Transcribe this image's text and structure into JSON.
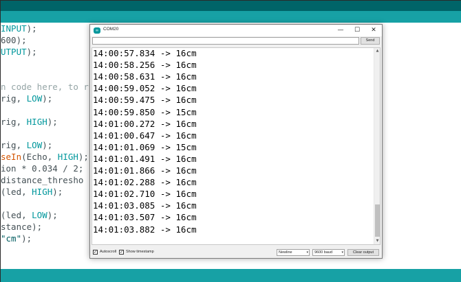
{
  "editor": {
    "lines": [
      {
        "pre": "",
        "a": "INPUT",
        "post": ");"
      },
      {
        "pre": "",
        "a": "600",
        "post": ");"
      },
      {
        "pre": "",
        "a": "UTPUT",
        "post": ");"
      },
      {
        "comment": "n code here, to r"
      },
      {
        "pre": "rig, ",
        "a": "LOW",
        "post": ");"
      },
      {
        "pre": "rig, ",
        "a": "HIGH",
        "post": ");"
      },
      {
        "pre": "rig, ",
        "a": "LOW",
        "post": ");"
      },
      {
        "fn": "seIn",
        "pre": "(Echo, ",
        "a": "HIGH",
        "post": ");"
      },
      {
        "text": "ion * 0.034 / 2;"
      },
      {
        "text": "distance_thresho"
      },
      {
        "pre": "(led, ",
        "a": "HIGH",
        "post": ");"
      },
      {
        "pre": "(led, ",
        "a": "LOW",
        "post": ");"
      },
      {
        "text": "stance);"
      },
      {
        "str": "\"cm\"",
        "post": ");"
      }
    ]
  },
  "serial_monitor": {
    "title": "COM20",
    "logo_text": "∞",
    "input_value": "",
    "send_label": "Send",
    "output_lines": [
      "14:00:57.834 -> 16cm",
      "14:00:58.256 -> 16cm",
      "14:00:58.631 -> 16cm",
      "14:00:59.052 -> 16cm",
      "14:00:59.475 -> 16cm",
      "14:00:59.850 -> 15cm",
      "14:01:00.272 -> 16cm",
      "14:01:00.647 -> 16cm",
      "14:01:01.069 -> 15cm",
      "14:01:01.491 -> 16cm",
      "14:01:01.866 -> 16cm",
      "14:01:02.288 -> 16cm",
      "14:01:02.710 -> 16cm",
      "14:01:03.085 -> 16cm",
      "14:01:03.507 -> 16cm",
      "14:01:03.882 -> 16cm"
    ],
    "autoscroll_label": "Autoscroll",
    "autoscroll_checked": true,
    "timestamp_label": "Show timestamp",
    "timestamp_checked": true,
    "line_ending": "Newline",
    "baud_rate": "9600 baud",
    "clear_label": "Clear output",
    "window_controls": {
      "minimize": "—",
      "maximize": "☐",
      "close": "✕"
    },
    "scroll_up_glyph": "▲",
    "scroll_down_glyph": "▼",
    "dropdown_glyph": "▾",
    "checkmark": "✓"
  },
  "colors": {
    "ide_dark_teal": "#006468",
    "ide_teal": "#17a1a5",
    "keyword_const": "#00979c",
    "keyword_func": "#d35400"
  }
}
